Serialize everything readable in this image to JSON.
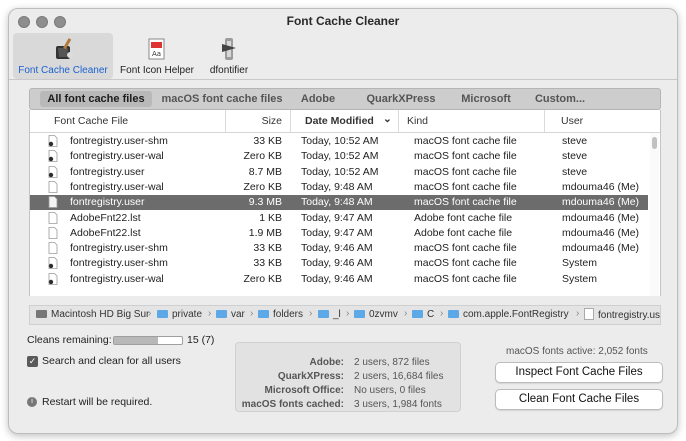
{
  "window": {
    "title": "Font Cache Cleaner"
  },
  "toolbar": {
    "items": [
      {
        "label": "Font Cache Cleaner",
        "icon": "broom-font-icon",
        "selected": true
      },
      {
        "label": "Font Icon Helper",
        "icon": "font-document-icon",
        "selected": false
      },
      {
        "label": "dfontifier",
        "icon": "font-converter-icon",
        "selected": false
      }
    ]
  },
  "tabs": [
    "All font cache files",
    "macOS font cache files",
    "Adobe",
    "QuarkXPress",
    "Microsoft",
    "Custom..."
  ],
  "table": {
    "columns": [
      "Font Cache File",
      "Size",
      "Date Modified",
      "Kind",
      "User"
    ],
    "sort_indicator": "⌄",
    "rows": [
      {
        "name": "fontregistry.user-shm",
        "size": "33 KB",
        "date": "Today, 10:52 AM",
        "kind": "macOS font cache file",
        "user": "steve",
        "icon": "exec"
      },
      {
        "name": "fontregistry.user-wal",
        "size": "Zero KB",
        "date": "Today, 10:52 AM",
        "kind": "macOS font cache file",
        "user": "steve",
        "icon": "exec"
      },
      {
        "name": "fontregistry.user",
        "size": "8.7 MB",
        "date": "Today, 10:52 AM",
        "kind": "macOS font cache file",
        "user": "steve",
        "icon": "exec"
      },
      {
        "name": "fontregistry.user-wal",
        "size": "Zero KB",
        "date": "Today, 9:48 AM",
        "kind": "macOS font cache file",
        "user": "mdouma46 (Me)",
        "icon": "doc"
      },
      {
        "name": "fontregistry.user",
        "size": "9.3 MB",
        "date": "Today, 9:48 AM",
        "kind": "macOS font cache file",
        "user": "mdouma46 (Me)",
        "icon": "doc",
        "selected": true
      },
      {
        "name": "AdobeFnt22.lst",
        "size": "1 KB",
        "date": "Today, 9:47 AM",
        "kind": "Adobe font cache file",
        "user": "mdouma46 (Me)",
        "icon": "doc"
      },
      {
        "name": "AdobeFnt22.lst",
        "size": "1.9 MB",
        "date": "Today, 9:47 AM",
        "kind": "Adobe font cache file",
        "user": "mdouma46 (Me)",
        "icon": "doc"
      },
      {
        "name": "fontregistry.user-shm",
        "size": "33 KB",
        "date": "Today, 9:46 AM",
        "kind": "macOS font cache file",
        "user": "mdouma46 (Me)",
        "icon": "doc"
      },
      {
        "name": "fontregistry.user-shm",
        "size": "33 KB",
        "date": "Today, 9:46 AM",
        "kind": "macOS font cache file",
        "user": "System",
        "icon": "exec"
      },
      {
        "name": "fontregistry.user-wal",
        "size": "Zero KB",
        "date": "Today, 9:46 AM",
        "kind": "macOS font cache file",
        "user": "System",
        "icon": "exec"
      }
    ]
  },
  "pathbar": [
    "Macintosh HD Big Sur",
    "private",
    "var",
    "folders",
    "_l",
    "0zvmv",
    "C",
    "com.apple.FontRegistry",
    "fontregistry.user"
  ],
  "status": {
    "cleans_label": "Cleans remaining:",
    "cleans_value": "15 (7)",
    "cleans_fraction": 0.65,
    "checkbox_label": "Search and clean for all users",
    "checkbox_checked": true,
    "restart_note": "Restart will be required.",
    "fonts_active": "macOS fonts active: 2,052 fonts"
  },
  "stats": [
    {
      "key": "Adobe:",
      "value": "2 users, 872 files"
    },
    {
      "key": "QuarkXPress:",
      "value": "2 users, 16,684 files"
    },
    {
      "key": "Microsoft Office:",
      "value": "No users, 0 files"
    },
    {
      "key": "macOS fonts cached:",
      "value": "3 users, 1,984 fonts"
    }
  ],
  "buttons": {
    "inspect": "Inspect Font Cache Files",
    "clean": "Clean Font Cache Files"
  },
  "colors": {
    "accent": "#1a62d1",
    "selection": "#6c6c6c",
    "folder": "#5da8e6"
  }
}
